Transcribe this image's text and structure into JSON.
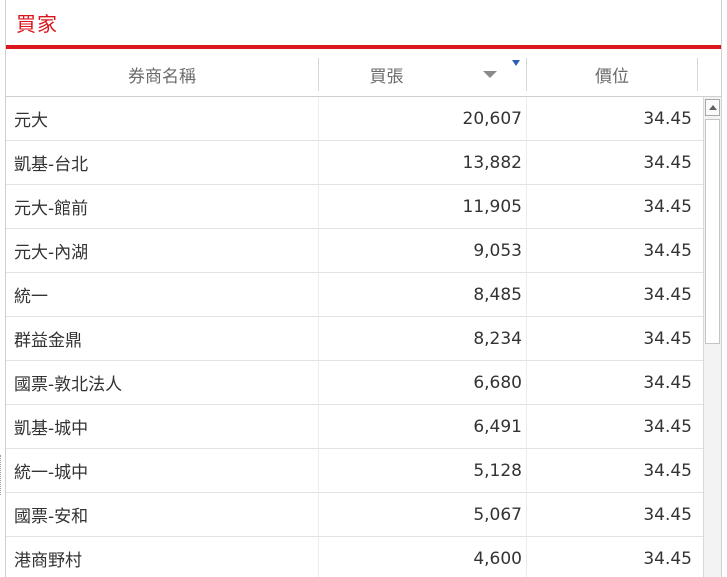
{
  "panel": {
    "title": "買家"
  },
  "columns": {
    "broker": "券商名稱",
    "volume": "買張",
    "price": "價位"
  },
  "rows": [
    {
      "broker": "元大",
      "volume": "20,607",
      "price": "34.45"
    },
    {
      "broker": "凱基-台北",
      "volume": "13,882",
      "price": "34.45"
    },
    {
      "broker": "元大-館前",
      "volume": "11,905",
      "price": "34.45"
    },
    {
      "broker": "元大-內湖",
      "volume": "9,053",
      "price": "34.45"
    },
    {
      "broker": "統一",
      "volume": "8,485",
      "price": "34.45"
    },
    {
      "broker": "群益金鼎",
      "volume": "8,234",
      "price": "34.45"
    },
    {
      "broker": "國票-敦北法人",
      "volume": "6,680",
      "price": "34.45"
    },
    {
      "broker": "凱基-城中",
      "volume": "6,491",
      "price": "34.45"
    },
    {
      "broker": "統一-城中",
      "volume": "5,128",
      "price": "34.45"
    },
    {
      "broker": "國票-安和",
      "volume": "5,067",
      "price": "34.45"
    },
    {
      "broker": "港商野村",
      "volume": "4,600",
      "price": "34.45"
    }
  ],
  "colors": {
    "accent": "#d9161c",
    "filter": "#2f5fb3"
  },
  "icons": {
    "sort": "sort-desc-arrow-icon",
    "filter": "filter-icon",
    "scroll_up": "scroll-up-arrow-icon"
  }
}
